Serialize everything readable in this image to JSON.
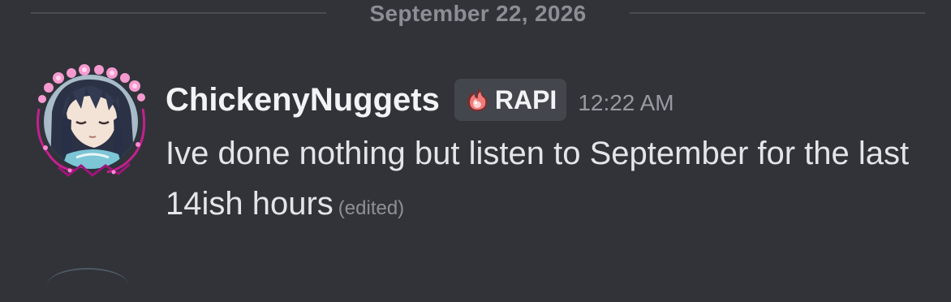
{
  "divider": {
    "date": "September 22, 2026"
  },
  "message": {
    "author": "ChickenyNuggets",
    "clan_tag": "RAPI",
    "timestamp": "12:22 AM",
    "text": "Ive done nothing but listen to September for the last 14ish hours",
    "edited_label": "(edited)",
    "avatar_icon": "anime-avatar-flower-crown",
    "clan_icon": "flame-badge-icon"
  },
  "colors": {
    "background": "#313338",
    "author": "#f2f3f5",
    "text": "#e3e5e8",
    "muted": "#979aa1",
    "tag_bg": "#44464d"
  }
}
